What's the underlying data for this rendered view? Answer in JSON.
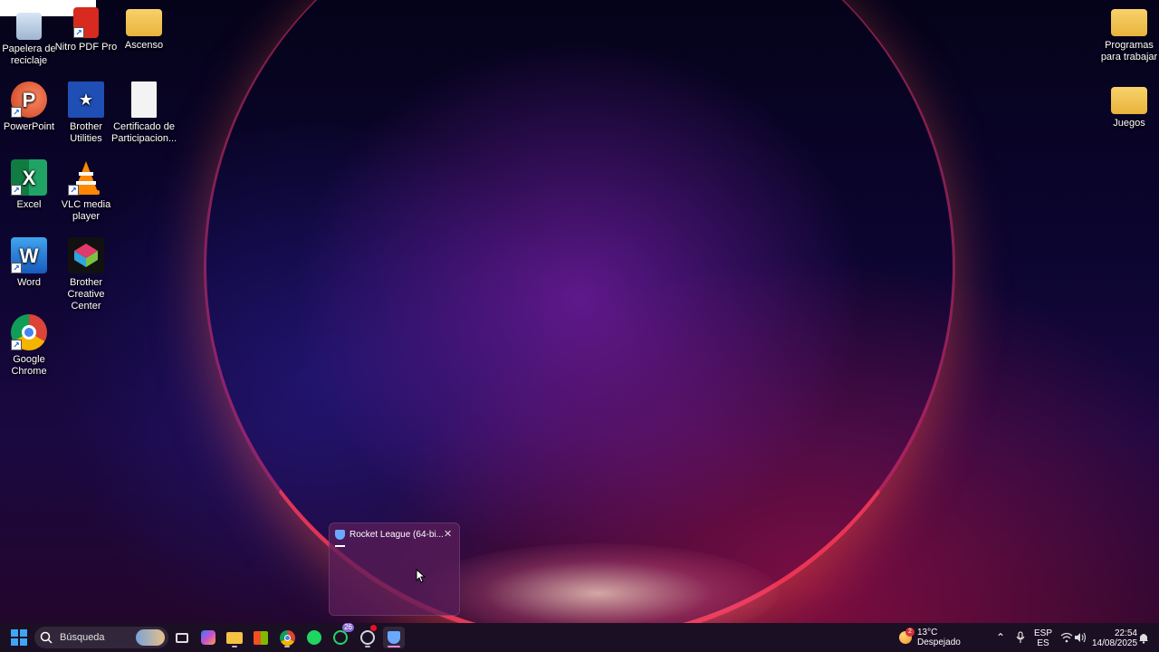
{
  "desktop": {
    "icons": [
      {
        "label": "Papelera de reciclaje"
      },
      {
        "label": "Nitro PDF Pro"
      },
      {
        "label": "Ascenso"
      },
      {
        "label": "PowerPoint"
      },
      {
        "label": "Brother Utilities"
      },
      {
        "label": "Certificado de Participacion..."
      },
      {
        "label": "Excel"
      },
      {
        "label": "VLC media player"
      },
      {
        "label": "Word"
      },
      {
        "label": "Brother Creative Center"
      },
      {
        "label": "Google Chrome"
      },
      {
        "label": "Programas para trabajar"
      },
      {
        "label": "Juegos"
      }
    ],
    "icon_glyphs": {
      "powerpoint": "P",
      "excel": "X",
      "word": "W"
    }
  },
  "taskbar_popup": {
    "title": "Rocket League (64-bi...",
    "close_glyph": "✕"
  },
  "taskbar": {
    "search_placeholder": "Búsqueda",
    "whatsapp_badge": "26",
    "weather": {
      "temp": "13°C",
      "condition": "Despejado",
      "badge": "2"
    },
    "language": {
      "line1": "ESP",
      "line2": "ES"
    },
    "clock": {
      "time": "22:54",
      "date": "14/08/2025"
    }
  },
  "colors": {
    "accent": "#0078d4",
    "taskbar_bg": "#1c1024",
    "active_indicator": "#e487d8"
  }
}
